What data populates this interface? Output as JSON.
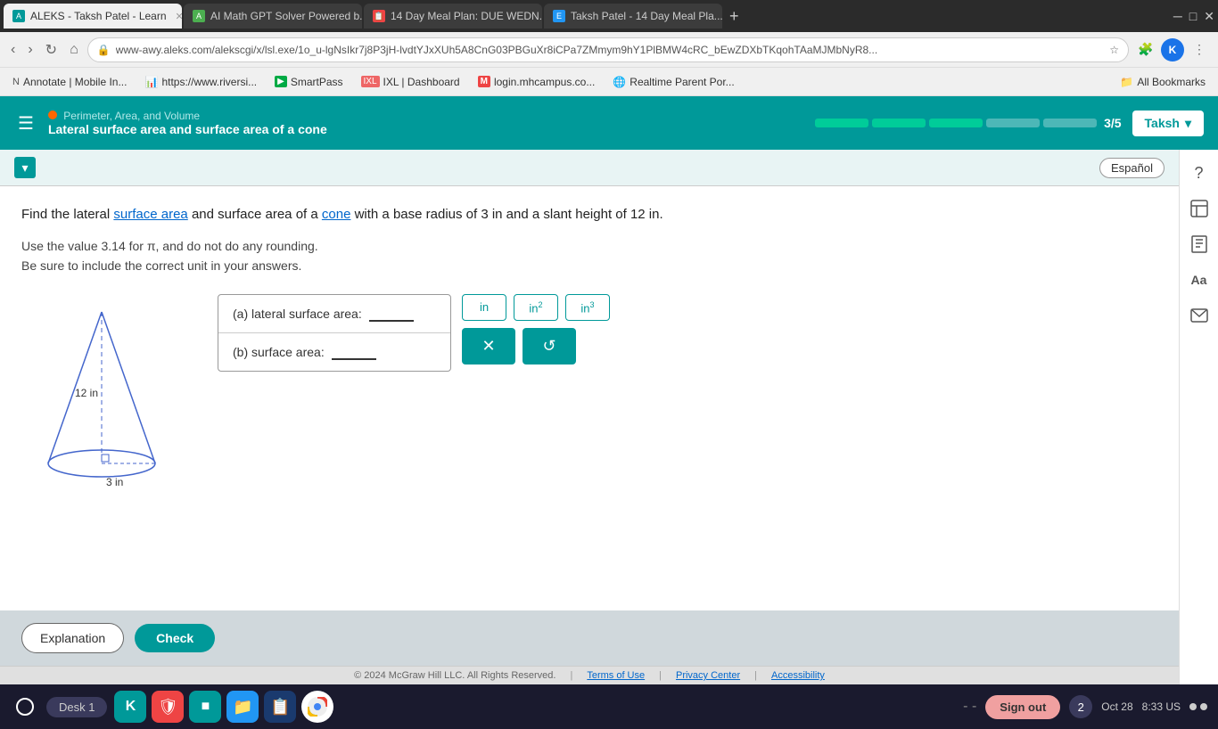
{
  "browser": {
    "tabs": [
      {
        "id": "tab1",
        "label": "ALEKS - Taksh Patel - Learn",
        "active": true,
        "favicon_color": "#009999"
      },
      {
        "id": "tab2",
        "label": "AI Math GPT Solver Powered b...",
        "active": false,
        "favicon_color": "#4CAF50"
      },
      {
        "id": "tab3",
        "label": "14 Day Meal Plan: DUE WEDN...",
        "active": false,
        "favicon_color": "#e44"
      },
      {
        "id": "tab4",
        "label": "Taksh Patel - 14 Day Meal Pla...",
        "active": false,
        "favicon_color": "#2196F3"
      }
    ],
    "url": "www-awy.aleks.com/alekscgi/x/lsl.exe/1o_u-lgNsIkr7j8P3jH-lvdtYJxXUh5A8CnG03PBGuXr8iCPa7ZMmym9hY1PlBMW4cRC_bEwZDXbTKqohTAaMJMbNyR8...",
    "bookmarks": [
      {
        "label": "Annotate | Mobile In...",
        "icon": "N"
      },
      {
        "label": "https://www.riversi...",
        "icon": "📊"
      },
      {
        "label": "SmartPass",
        "icon": "S"
      },
      {
        "label": "IXL | Dashboard",
        "icon": "IXL"
      },
      {
        "label": "login.mhcampus.co...",
        "icon": "M"
      },
      {
        "label": "Realtime Parent Por...",
        "icon": "🌐"
      },
      {
        "label": "All Bookmarks",
        "icon": "📁"
      }
    ]
  },
  "aleks": {
    "header": {
      "topic": "Perimeter, Area, and Volume",
      "subtitle": "Lateral surface area and surface area of a cone",
      "progress_filled": 3,
      "progress_total": 5,
      "progress_label": "3/5",
      "user": "Taksh"
    },
    "question": {
      "text1": "Find the lateral ",
      "link1": "surface area",
      "text2": " and surface area of a ",
      "link2": "cone",
      "text3": " with a base radius of 3 in and a slant height of 12 in.",
      "hint1": "Use the value 3.14 for π, and do not do any rounding.",
      "hint2": "Be sure to include the correct unit in your answers.",
      "part_a_label": "(a)  lateral surface area:",
      "part_b_label": "(b)  surface area:",
      "cone_height": "12 in",
      "cone_radius": "3 in"
    },
    "units": {
      "btn1": "in",
      "btn2": "in²",
      "btn3": "in³"
    },
    "buttons": {
      "explanation": "Explanation",
      "check": "Check",
      "espanol": "Español"
    },
    "footer": {
      "copyright": "© 2024 McGraw Hill LLC. All Rights Reserved.",
      "terms": "Terms of Use",
      "privacy": "Privacy Center",
      "accessibility": "Accessibility"
    }
  },
  "taskbar": {
    "desk": "Desk 1",
    "sign_out": "Sign out",
    "date": "Oct 28",
    "time": "8:33 US",
    "notification_count": "2"
  }
}
